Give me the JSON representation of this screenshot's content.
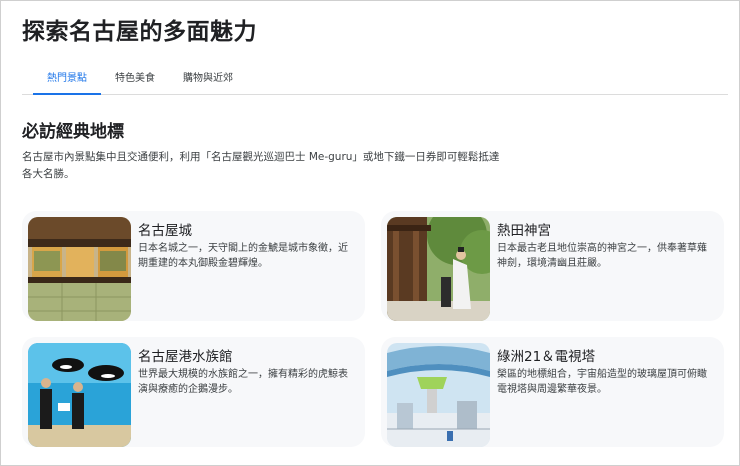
{
  "page": {
    "title": "探索名古屋的多面魅力"
  },
  "tabs": [
    {
      "label": "熱門景點",
      "active": true
    },
    {
      "label": "特色美食",
      "active": false
    },
    {
      "label": "購物與近郊",
      "active": false
    }
  ],
  "section": {
    "title": "必訪經典地標",
    "description": "名古屋市內景點集中且交通便利，利用「名古屋觀光巡迴巴士 Me-guru」或地下鐵一日券即可輕鬆抵達各大名勝。"
  },
  "cards": [
    {
      "name": "名古屋城",
      "text": "日本名城之一，天守閣上的金鯱是城市象徵，近期重建的本丸御殿金碧輝煌。",
      "image": "palace-interior"
    },
    {
      "name": "熱田神宮",
      "text": "日本最古老且地位崇高的神宮之一，供奉著草薙神劍，環境清幽且莊嚴。",
      "image": "shrine-priest"
    },
    {
      "name": "名古屋港水族館",
      "text": "世界最大規模的水族館之一，擁有精彩的虎鯨表演與療癒的企鵝漫步。",
      "image": "orca-tank"
    },
    {
      "name": "綠洲21＆電視塔",
      "text": "榮區的地標組合，宇宙船造型的玻璃屋頂可俯瞰電視塔與周邊繁華夜景。",
      "image": "glass-roof"
    }
  ],
  "colors": {
    "accent": "#1a73e8",
    "card_bg": "#f7f8fa"
  }
}
